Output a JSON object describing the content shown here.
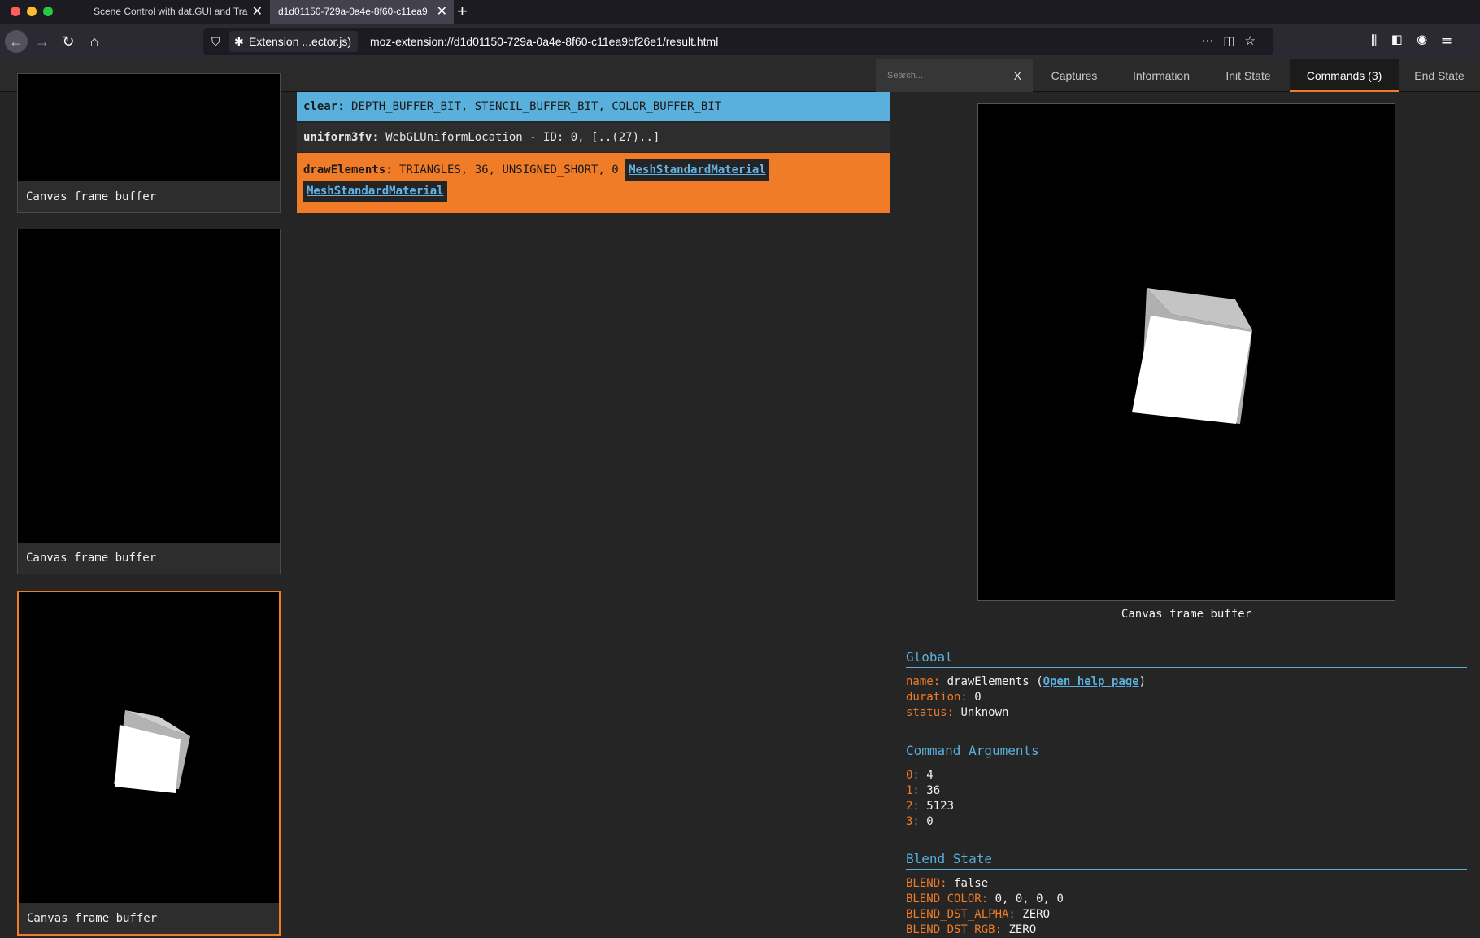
{
  "browser": {
    "tabs": [
      {
        "title": "Scene Control with dat.GUI and Tra"
      },
      {
        "title": "d1d01150-729a-0a4e-8f60-c11ea9"
      }
    ],
    "extension_label": "Extension ...ector.js)",
    "url": "moz-extension://d1d01150-729a-0a4e-8f60-c11ea9bf26e1/result.html"
  },
  "menu": {
    "search_placeholder": "Search...",
    "search_clear": "X",
    "items": [
      "Captures",
      "Information",
      "Init State",
      "Commands (3)",
      "End State"
    ],
    "active": "Commands (3)"
  },
  "visual_states": [
    {
      "caption": "Canvas frame buffer",
      "shows_cube": false
    },
    {
      "caption": "Canvas frame buffer",
      "shows_cube": false
    },
    {
      "caption": "Canvas frame buffer",
      "shows_cube": true,
      "selected": true
    }
  ],
  "commands": [
    {
      "name": "clear",
      "args": ": DEPTH_BUFFER_BIT, STENCIL_BUFFER_BIT, COLOR_BUFFER_BIT",
      "status_color": "#5ab0dd"
    },
    {
      "name": "uniform3fv",
      "args": ": WebGLUniformLocation - ID: 0, [..(27)..]",
      "status_color": "#2d2d2d"
    },
    {
      "name": "drawElements",
      "args": ": TRIANGLES, 36, UNSIGNED_SHORT, 0",
      "tags": [
        "MeshStandardMaterial",
        "MeshStandardMaterial"
      ],
      "status_color": "#f07c27"
    }
  ],
  "detail": {
    "preview_caption": "Canvas frame buffer",
    "global": {
      "title": "Global",
      "name_label": "name:",
      "name_value": "drawElements",
      "help_link": "Open help page",
      "duration_label": "duration:",
      "duration_value": "0",
      "status_label": "status:",
      "status_value": "Unknown"
    },
    "command_arguments": {
      "title": "Command Arguments",
      "items": [
        {
          "k": "0:",
          "v": "4"
        },
        {
          "k": "1:",
          "v": "36"
        },
        {
          "k": "2:",
          "v": "5123"
        },
        {
          "k": "3:",
          "v": "0"
        }
      ]
    },
    "blend_state": {
      "title": "Blend State",
      "items": [
        {
          "k": "BLEND:",
          "v": "false"
        },
        {
          "k": "BLEND_COLOR:",
          "v": "0, 0, 0, 0"
        },
        {
          "k": "BLEND_DST_ALPHA:",
          "v": "ZERO"
        },
        {
          "k": "BLEND_DST_RGB:",
          "v": "ZERO"
        }
      ]
    }
  },
  "colors": {
    "accent_orange": "#f07c27",
    "accent_blue": "#5ab0dd",
    "background": "#252525"
  }
}
